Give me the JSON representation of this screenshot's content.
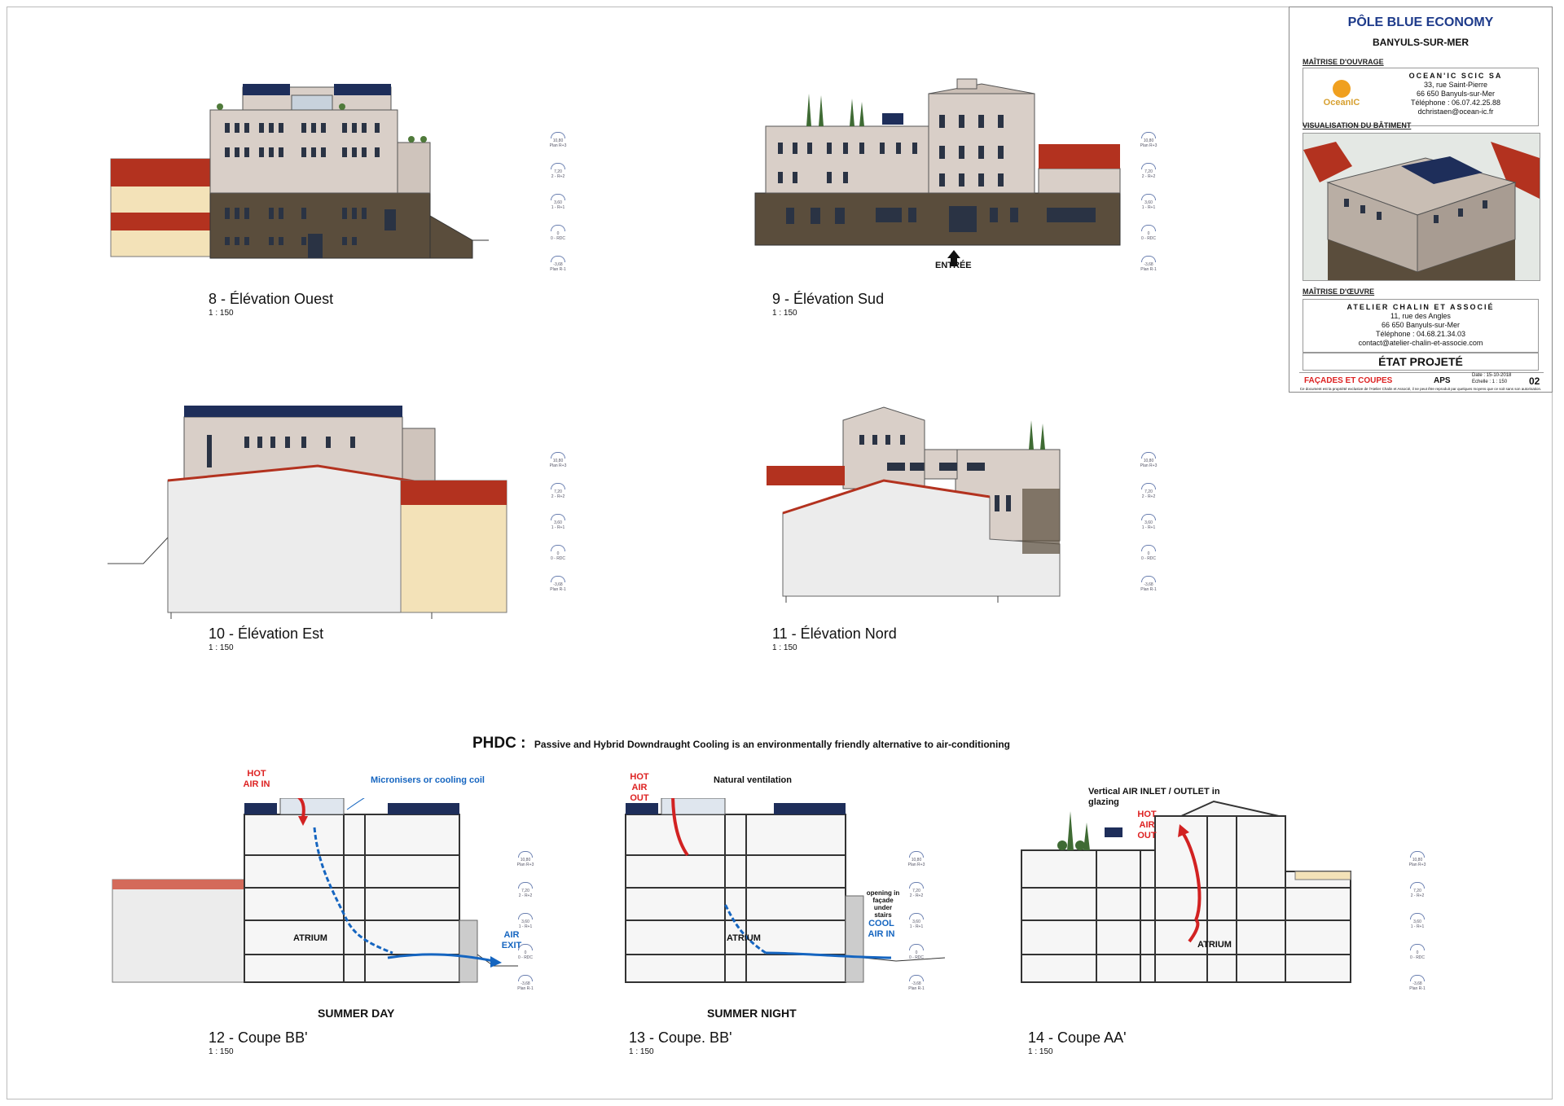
{
  "views": {
    "v8": {
      "title": "8 -  Élévation Ouest",
      "scale": "1 : 150"
    },
    "v9": {
      "title": "9 -  Élévation Sud",
      "scale": "1 : 150",
      "entry": "ENTRÉE"
    },
    "v10": {
      "title": "10 -  Élévation Est",
      "scale": "1 : 150"
    },
    "v11": {
      "title": "11 -  Élévation Nord",
      "scale": "1 : 150"
    },
    "v12": {
      "title": "12 -  Coupe  BB'",
      "scale": "1 : 150",
      "caption": "SUMMER DAY"
    },
    "v13": {
      "title": "13 -  Coupe. BB'",
      "scale": "1 : 150",
      "caption": "SUMMER NIGHT"
    },
    "v14": {
      "title": "14 -  Coupe  AA'",
      "scale": "1 : 150"
    }
  },
  "levels": [
    {
      "name": "10,80",
      "sub": "Plan R+3"
    },
    {
      "name": "7,20",
      "sub": "2 - R+2"
    },
    {
      "name": "3,60",
      "sub": "1 - R+1"
    },
    {
      "name": "0",
      "sub": "0 - RDC"
    },
    {
      "name": "-3,68",
      "sub": "Plan R-1"
    }
  ],
  "phdc": {
    "head": "PHDC :",
    "text": "Passive and Hybrid Downdraught Cooling is an environmentally friendly alternative to air-conditioning"
  },
  "annotations": {
    "hot_air_in": "HOT AIR IN",
    "micronisers": "Micronisers or cooling coil",
    "air_exit": "AIR EXIT",
    "atrium": "ATRIUM",
    "hot_air_out": "HOT AIR OUT",
    "natural_ventilation": "Natural ventilation",
    "opening": "opening in façade under stairs",
    "cool_air_in": "COOL AIR IN",
    "vertical_inlet": "Vertical AIR INLET / OUTLET in glazing"
  },
  "titleblock": {
    "project": "PÔLE BLUE ECONOMY",
    "town": "BANYULS-SUR-MER",
    "owner_section": "MAÎTRISE D'OUVRAGE",
    "owner_logo": "OceanIC",
    "owner_name": "OCEAN'IC SCIC SA",
    "owner_lines": [
      "33, rue Saint-Pierre",
      "66 650 Banyuls-sur-Mer",
      "Téléphone : 06.07.42.25.88",
      "dchristaen@ocean-ic.fr"
    ],
    "visual_section": "VISUALISATION DU BÂTIMENT",
    "architect_section": "MAÎTRISE D'ŒUVRE",
    "architect_name": "ATELIER CHALIN ET ASSOCIÉ",
    "architect_lines": [
      "11, rue des Angles",
      "66 650 Banyuls-sur-Mer",
      "Téléphone : 04.68.21.34.03",
      "contact@atelier-chalin-et-associe.com"
    ],
    "state": "ÉTAT PROJETÉ",
    "sheet_title": "FAÇADES ET COUPES",
    "phase": "APS",
    "date": "Date : 15-10-2018",
    "echelle": "Echelle : 1 : 150",
    "sheet_no": "02",
    "disclaimer": "Ce document est la propriété exclusive de l'Atelier Chalin et Associé, il ne peut être reproduit par quelques moyens que ce soit sans son autorisation."
  },
  "colors": {
    "stone": "#5a4d3c",
    "facade": "#d9cfc8",
    "roof_tile": "#b3321f",
    "solar": "#1e2e5a",
    "plaster": "#f3e2b8",
    "hot": "#d22222",
    "cool": "#1565c0"
  }
}
